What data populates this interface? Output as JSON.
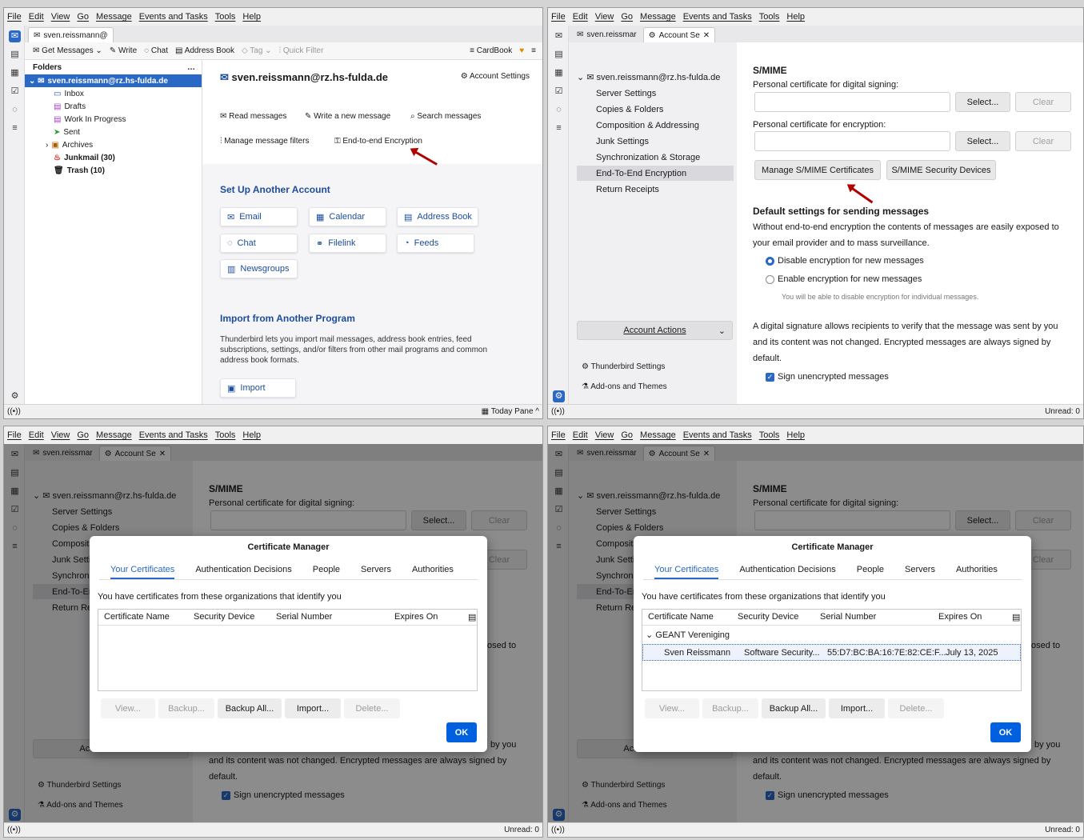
{
  "menu": [
    "File",
    "Edit",
    "View",
    "Go",
    "Message",
    "Events and Tasks",
    "Tools",
    "Help"
  ],
  "q1": {
    "tab": "sven.reissmann@",
    "toolbar": {
      "get": "Get Messages",
      "write": "Write",
      "chat": "Chat",
      "ab": "Address Book",
      "tag": "Tag",
      "qf": "Quick Filter",
      "cardbook": "CardBook"
    },
    "folders_header": "Folders",
    "account": "sven.reissmann@rz.hs-fulda.de",
    "folders": [
      "Inbox",
      "Drafts",
      "Work In Progress",
      "Sent",
      "Archives"
    ],
    "junk": "Junkmail (30)",
    "trash": "Trash (10)",
    "main": {
      "email": "sven.reissmann@rz.hs-fulda.de",
      "acct_settings": "Account Settings",
      "read": "Read messages",
      "write_new": "Write a new message",
      "search": "Search messages",
      "filters": "Manage message filters",
      "e2e": "End-to-end Encryption",
      "setup_title": "Set Up Another Account",
      "btn_email": "Email",
      "btn_calendar": "Calendar",
      "btn_ab": "Address Book",
      "btn_chat": "Chat",
      "btn_filelink": "Filelink",
      "btn_feeds": "Feeds",
      "btn_news": "Newsgroups",
      "import_title": "Import from Another Program",
      "import_desc": "Thunderbird lets you import mail messages, address book entries, feed subscriptions, settings, and/or filters from other mail programs and common address book formats.",
      "import_btn": "Import"
    },
    "status_right": "Today Pane"
  },
  "acct": {
    "tab1": "sven.reissmar",
    "tab2": "Account Se",
    "account": "sven.reissmann@rz.hs-fulda.de",
    "nav": [
      "Server Settings",
      "Copies & Folders",
      "Composition & Addressing",
      "Junk Settings",
      "Synchronization & Storage",
      "End-To-End Encryption",
      "Return Receipts"
    ],
    "actions": "Account Actions",
    "tb_settings": "Thunderbird Settings",
    "addons": "Add-ons and Themes",
    "smime": "S/MIME",
    "sign_label": "Personal certificate for digital signing:",
    "enc_label": "Personal certificate for encryption:",
    "select": "Select...",
    "clear": "Clear",
    "manage": "Manage S/MIME Certificates",
    "devices": "S/MIME Security Devices",
    "default_title": "Default settings for sending messages",
    "default_desc1": "Without end-to-end encryption the contents of messages are easily exposed to",
    "default_desc2": "your email provider and to mass surveillance.",
    "disable": "Disable encryption for new messages",
    "enable": "Enable encryption for new messages",
    "enable_note": "You will be able to disable encryption for individual messages.",
    "sig1": "A digital signature allows recipients to verify that the message was sent by you",
    "sig2": "and its content was not changed. Encrypted messages are always signed by",
    "sig3": "default.",
    "sign_unenc": "Sign unencrypted messages",
    "unread": "Unread: 0"
  },
  "dlg": {
    "title": "Certificate Manager",
    "tabs": [
      "Your Certificates",
      "Authentication Decisions",
      "People",
      "Servers",
      "Authorities"
    ],
    "intro": "You have certificates from these organizations that identify you",
    "cols": [
      "Certificate Name",
      "Security Device",
      "Serial Number",
      "Expires On"
    ],
    "group": "GEANT Vereniging",
    "row": {
      "name": "Sven Reissmann",
      "device": "Software Security...",
      "serial": "55:D7:BC:BA:16:7E:82:CE:F...",
      "expires": "July 13, 2025"
    },
    "btns": [
      "View...",
      "Backup...",
      "Backup All...",
      "Import...",
      "Delete..."
    ],
    "ok": "OK",
    "behind_tail": "osed to",
    "behind_tail2": "by you"
  }
}
